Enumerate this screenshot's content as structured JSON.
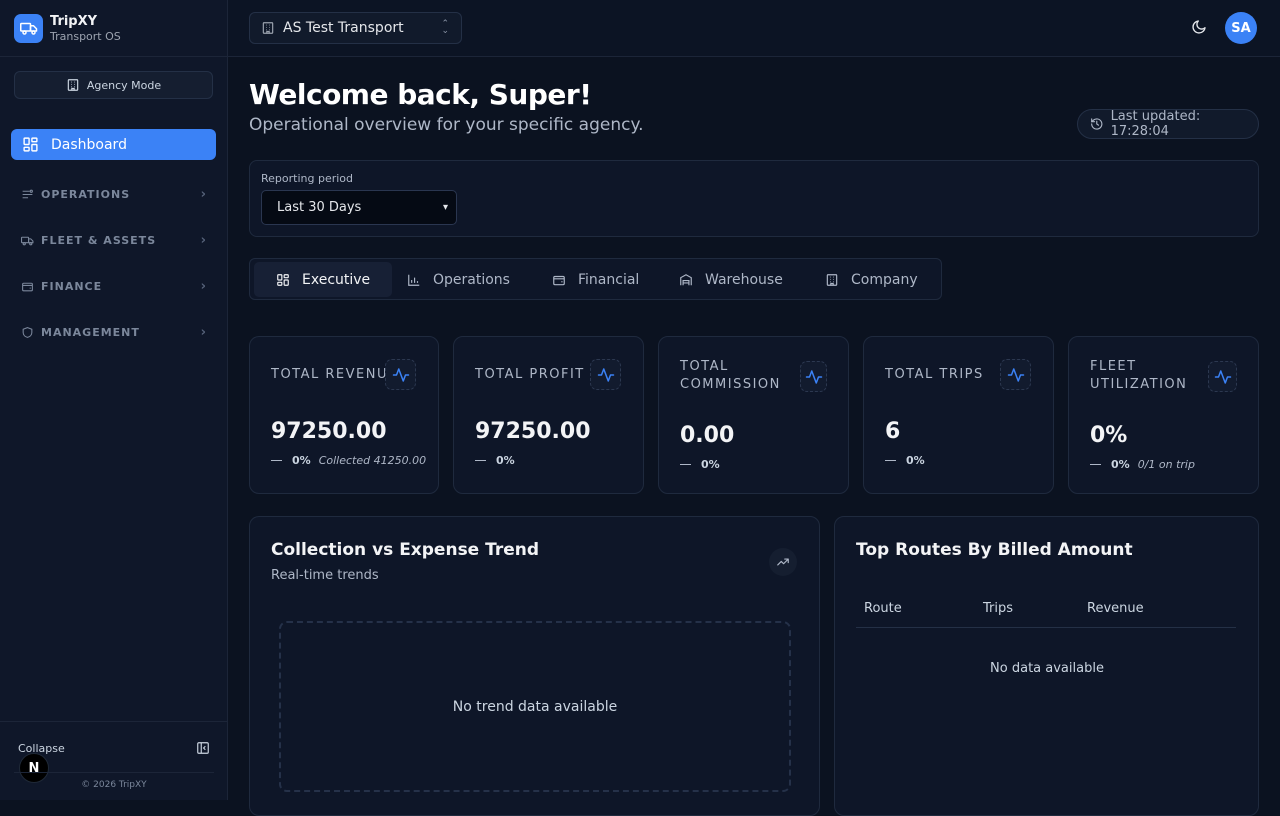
{
  "brand": {
    "name": "TripXY",
    "subtitle": "Transport OS"
  },
  "sidebar": {
    "mode": "Agency Mode",
    "active_item": "Dashboard",
    "sections": [
      {
        "label": "OPERATIONS"
      },
      {
        "label": "FLEET & ASSETS"
      },
      {
        "label": "FINANCE"
      },
      {
        "label": "MANAGEMENT"
      }
    ],
    "collapse_label": "Collapse",
    "avatar_letter": "N",
    "copyright": "© 2026 TripXY"
  },
  "topbar": {
    "agency": "AS Test Transport",
    "avatar_initials": "SA"
  },
  "header": {
    "title": "Welcome back, Super!",
    "subtitle": "Operational overview for your specific agency.",
    "last_updated": "Last updated: 17:28:04"
  },
  "period": {
    "label": "Reporting period",
    "value": "Last 30 Days"
  },
  "tabs": [
    {
      "label": "Executive"
    },
    {
      "label": "Operations"
    },
    {
      "label": "Financial"
    },
    {
      "label": "Warehouse"
    },
    {
      "label": "Company"
    }
  ],
  "kpis": [
    {
      "title": "TOTAL REVENUE",
      "value": "97250.00",
      "delta": "0%",
      "note": "Collected 41250.00"
    },
    {
      "title": "TOTAL PROFIT",
      "value": "97250.00",
      "delta": "0%",
      "note": ""
    },
    {
      "title": "TOTAL COMMISSION",
      "value": "0.00",
      "delta": "0%",
      "note": ""
    },
    {
      "title": "TOTAL TRIPS",
      "value": "6",
      "delta": "0%",
      "note": ""
    },
    {
      "title": "FLEET UTILIZATION",
      "value": "0%",
      "delta": "0%",
      "note": "0/1 on trip"
    }
  ],
  "trend_panel": {
    "title": "Collection vs Expense Trend",
    "subtitle": "Real-time trends",
    "empty": "No trend data available"
  },
  "routes_panel": {
    "title": "Top Routes By Billed Amount",
    "columns": [
      "Route",
      "Trips",
      "Revenue"
    ],
    "empty": "No data available"
  },
  "colors": {
    "accent": "#3b82f6",
    "background": "#0b1220",
    "sidebar": "#0f1729"
  }
}
